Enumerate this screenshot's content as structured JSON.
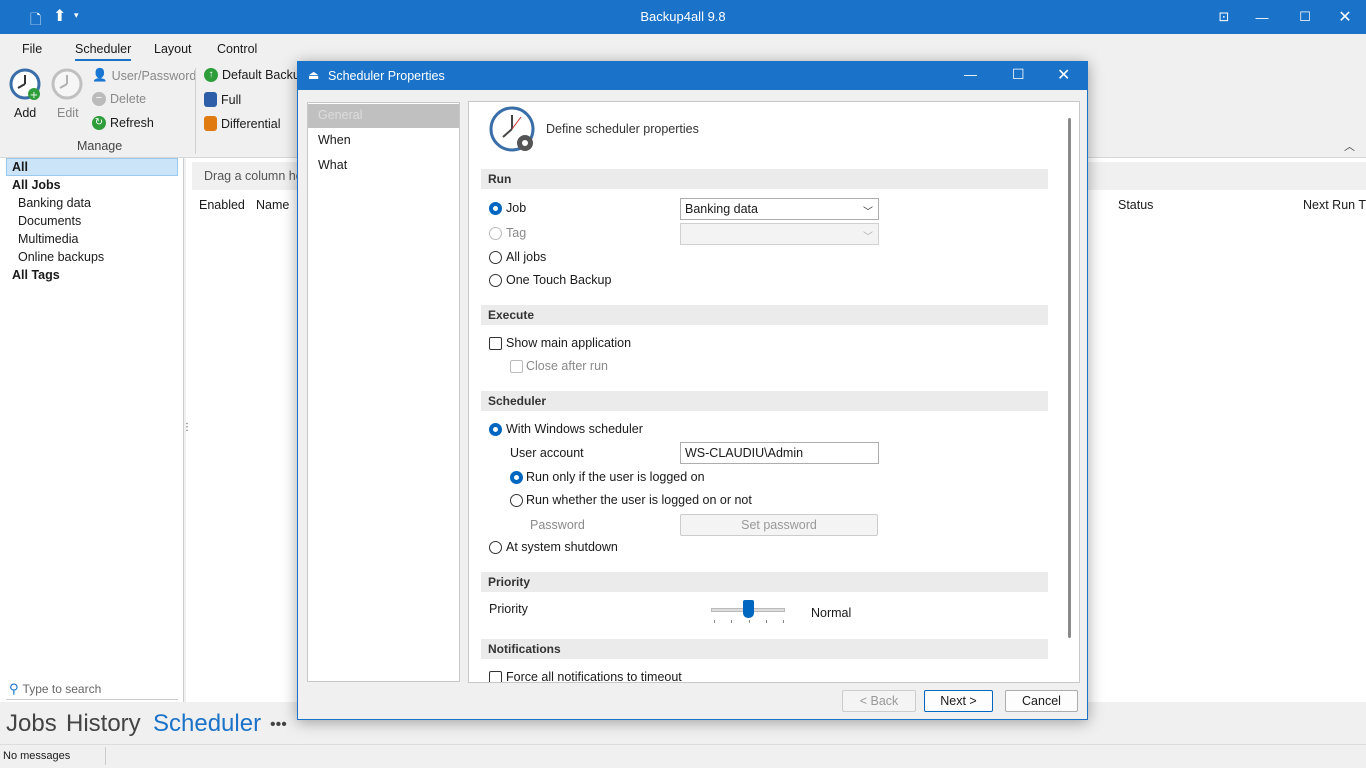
{
  "app": {
    "title": "Backup4all 9.8"
  },
  "menu": {
    "file": "File",
    "scheduler": "Scheduler",
    "layout": "Layout",
    "control": "Control"
  },
  "ribbon": {
    "add": "Add",
    "edit": "Edit",
    "user_password": "User/Password",
    "delete": "Delete",
    "refresh": "Refresh",
    "manage": "Manage",
    "default_backup": "Default Backu",
    "full": "Full",
    "differential": "Differential"
  },
  "tree": {
    "all": "All",
    "all_jobs": "All Jobs",
    "banking": "Banking data",
    "documents": "Documents",
    "multimedia": "Multimedia",
    "online": "Online backups",
    "all_tags": "All Tags"
  },
  "search": {
    "placeholder": "Type to search"
  },
  "grid": {
    "drag_hint": "Drag a column he",
    "col_enabled": "Enabled",
    "col_name": "Name",
    "col_status": "Status",
    "col_next": "Next Run Ti"
  },
  "bottom_tabs": {
    "jobs": "Jobs",
    "history": "History",
    "scheduler": "Scheduler",
    "more": "•••"
  },
  "status": {
    "message": "No messages"
  },
  "dialog": {
    "title": "Scheduler Properties",
    "nav": {
      "general": "General",
      "when": "When",
      "what": "What"
    },
    "header": "Define scheduler properties",
    "run": {
      "title": "Run",
      "job": "Job",
      "tag": "Tag",
      "all_jobs": "All jobs",
      "one_touch": "One Touch Backup",
      "job_value": "Banking data",
      "tag_value": ""
    },
    "execute": {
      "title": "Execute",
      "show_main": "Show main application",
      "close_after": "Close after run"
    },
    "scheduler": {
      "title": "Scheduler",
      "with_windows": "With Windows scheduler",
      "user_account": "User account",
      "user_value": "WS-CLAUDIU\\Admin",
      "run_logged_on": "Run only if the user is logged on",
      "run_whether": "Run whether the user is logged on or not",
      "password": "Password",
      "set_password": "Set password",
      "at_shutdown": "At system shutdown"
    },
    "priority": {
      "title": "Priority",
      "label": "Priority",
      "value_label": "Normal",
      "level": 0.5
    },
    "notifications": {
      "title": "Notifications",
      "force_timeout": "Force all notifications to timeout"
    },
    "buttons": {
      "back": "< Back",
      "next": "Next >",
      "cancel": "Cancel"
    }
  }
}
